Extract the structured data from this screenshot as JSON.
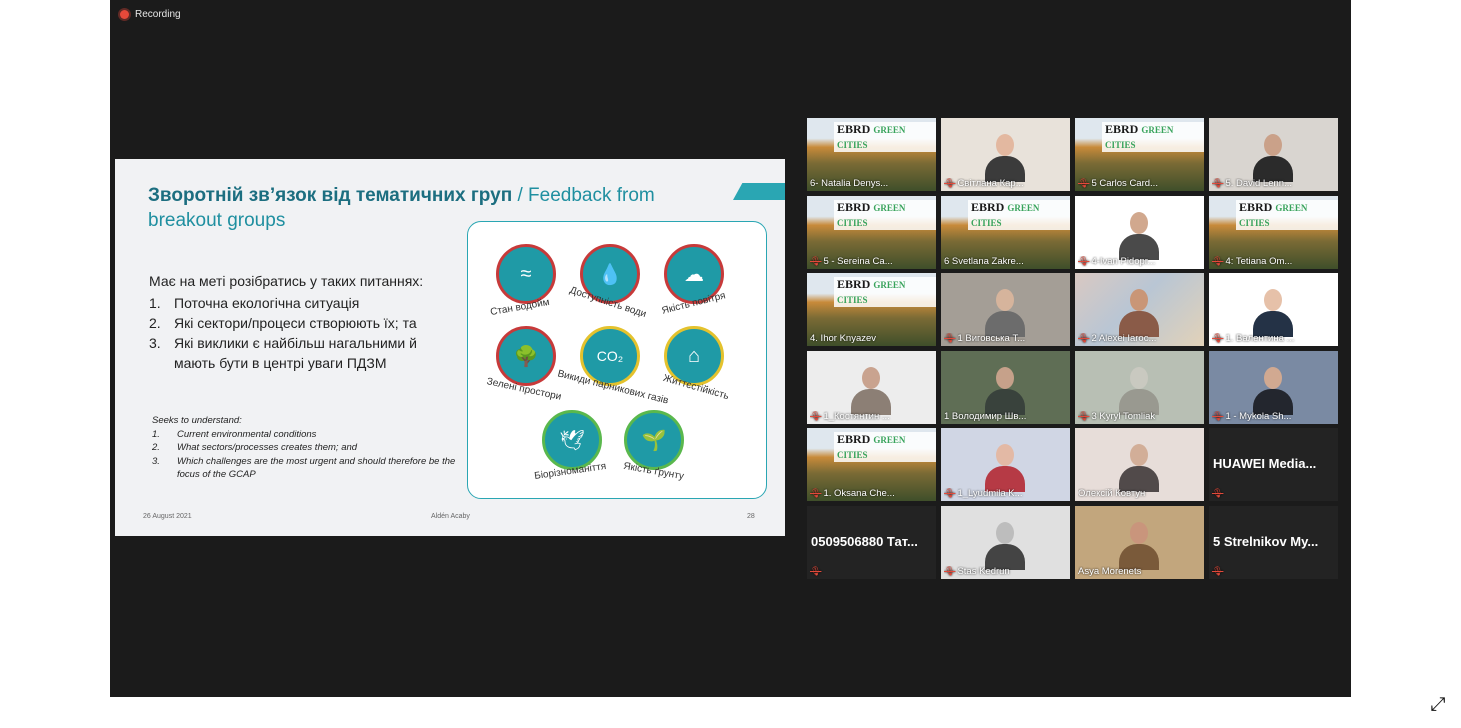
{
  "recording": {
    "label": "Recording"
  },
  "slide": {
    "title_ua": "Зворотній зв’язок від тематичних груп",
    "title_sep": " / ",
    "title_en": "Feedback from breakout groups",
    "intro_ua": "Має на меті розібратись у таких питаннях:",
    "items_ua": [
      {
        "num": "1.",
        "text": "Поточна екологічна ситуація"
      },
      {
        "num": "2.",
        "text": "Які сектори/процеси створюють їх; та"
      },
      {
        "num": "3.",
        "text": "Які виклики є найбільш нагальними й мають бути в центрі уваги ПДЗМ"
      }
    ],
    "intro_en": "Seeks to understand:",
    "items_en": [
      {
        "num": "1.",
        "text": "Current environmental conditions"
      },
      {
        "num": "2.",
        "text": "What sectors/processes creates them; and"
      },
      {
        "num": "3.",
        "text": "Which challenges are the most urgent and should therefore be the focus of the GCAP"
      }
    ],
    "icons": [
      {
        "label": "Стан водойм",
        "icon": "river-icon",
        "glyph": "≈"
      },
      {
        "label": "Доступність води",
        "icon": "water-drop-icon",
        "glyph": "💧"
      },
      {
        "label": "Якість повітря",
        "icon": "cloud-icon",
        "glyph": "☁"
      },
      {
        "label": "Зелені простори",
        "icon": "tree-icon",
        "glyph": "🌳"
      },
      {
        "label": "Викиди парникових газів",
        "icon": "co2-icon",
        "glyph": "CO₂"
      },
      {
        "label": "Життєстійкість",
        "icon": "flood-house-icon",
        "glyph": "⌂"
      },
      {
        "label": "Біорізноманіття",
        "icon": "bird-fish-icon",
        "glyph": "🕊"
      },
      {
        "label": "Якість ґрунту",
        "icon": "grass-icon",
        "glyph": "🌱"
      }
    ],
    "footer": {
      "date": "26 August 2021",
      "author": "Aldén Acaby",
      "page": "28"
    }
  },
  "ebrd": {
    "brand": "EBRD",
    "sub": "GREEN CITIES"
  },
  "participants": [
    {
      "name": "6- Natalia Denys...",
      "muted": false,
      "bg": "ebrd"
    },
    {
      "name": "Світлана Кар...",
      "muted": true,
      "bg": "room",
      "skin": "#e3b8a0",
      "shirt": "#3b3b3b",
      "wall": "#e8e2da"
    },
    {
      "name": "5 Carlos Card...",
      "muted": true,
      "bg": "ebrd"
    },
    {
      "name": "5. David Lenn...",
      "muted": true,
      "bg": "room",
      "skin": "#caa189",
      "shirt": "#2b2b2b",
      "wall": "#d9d5d0"
    },
    {
      "name": "5 - Sereina Ca...",
      "muted": true,
      "bg": "ebrd"
    },
    {
      "name": "6 Svetlana Zakre...",
      "muted": false,
      "bg": "ebrd"
    },
    {
      "name": "4-Ivan Pidopr...",
      "muted": true,
      "bg": "room",
      "skin": "#d1a88e",
      "shirt": "#4a4a4a",
      "wall": "#ffffff"
    },
    {
      "name": "4: Tetiana Om...",
      "muted": true,
      "bg": "ebrd"
    },
    {
      "name": "4. Ihor Knyazev",
      "muted": false,
      "bg": "ebrd"
    },
    {
      "name": "1 Виговська Т...",
      "muted": true,
      "bg": "room",
      "skin": "#d6b49c",
      "shirt": "#6c6c6c",
      "wall": "#a49e96"
    },
    {
      "name": "2 Alexei Iaroc...",
      "muted": true,
      "bg": "map",
      "skin": "#c99677",
      "shirt": "#8a5b48",
      "wall": "#c7b7b0"
    },
    {
      "name": "1. Валентина ...",
      "muted": true,
      "bg": "room",
      "skin": "#e6c1a9",
      "shirt": "#243246",
      "wall": "#ffffff"
    },
    {
      "name": "1_Костянтин ...",
      "muted": true,
      "bg": "room",
      "skin": "#c9a38f",
      "shirt": "#8c7f75",
      "wall": "#ededed"
    },
    {
      "name": "1 Володимир Шв...",
      "muted": false,
      "bg": "room",
      "skin": "#c6a18a",
      "shirt": "#39423c",
      "wall": "#5f6e55",
      "active": true
    },
    {
      "name": "3 Kyryl Tomliak",
      "muted": true,
      "bg": "room",
      "skin": "#c9c9c0",
      "shirt": "#999990",
      "wall": "#b8bfb4"
    },
    {
      "name": "1 - Mykola Sh...",
      "muted": true,
      "bg": "room",
      "skin": "#d1a991",
      "shirt": "#23262e",
      "wall": "#7a8aa3"
    },
    {
      "name": "1. Oksana Che...",
      "muted": true,
      "bg": "ebrd"
    },
    {
      "name": "1_Lyudmila K...",
      "muted": true,
      "bg": "room",
      "skin": "#e3b9a5",
      "shirt": "#b63a45",
      "wall": "#d0d6e4"
    },
    {
      "name": "Олексій Ковтун",
      "muted": false,
      "bg": "room",
      "skin": "#d2ae98",
      "shirt": "#514a4a",
      "wall": "#e7ddd9"
    },
    {
      "name": "HUAWEI Media...",
      "muted": true,
      "bg": "none",
      "big": "HUAWEI Media...",
      "show_name": false
    },
    {
      "name": "0509506880 Тат...",
      "muted": true,
      "bg": "none",
      "big": "0509506880 Тат...",
      "show_name": false
    },
    {
      "name": "Stas Kedrun",
      "muted": true,
      "bg": "room",
      "skin": "#bdbdbd",
      "shirt": "#444444",
      "wall": "#e0e0e0"
    },
    {
      "name": "Asya Morenets",
      "muted": false,
      "bg": "room",
      "skin": "#c9957c",
      "shirt": "#7a5a3a",
      "wall": "#c2a67d"
    },
    {
      "name": "5 Strelnikov My...",
      "muted": true,
      "bg": "none",
      "big": "5 Strelnikov My...",
      "show_name": false
    }
  ],
  "controls": {
    "expand_icon": "expand-icon",
    "expand_glyph": "⤢"
  }
}
